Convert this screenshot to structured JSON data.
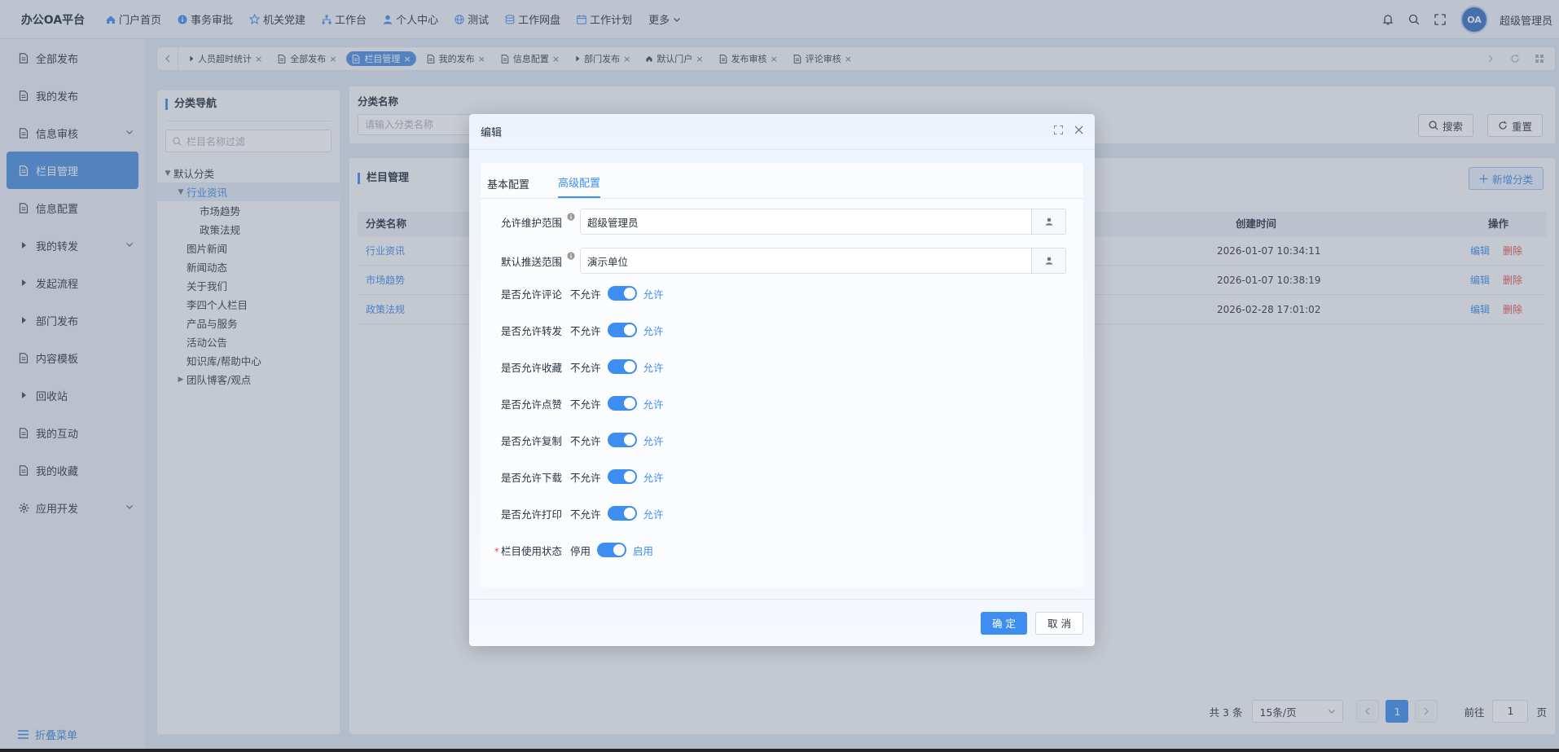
{
  "app": {
    "brand": "办公OA平台"
  },
  "topnav": {
    "items": [
      {
        "label": "门户首页",
        "icon": "home-icon"
      },
      {
        "label": "事务审批",
        "icon": "info-circle-icon"
      },
      {
        "label": "机关党建",
        "icon": "star-icon"
      },
      {
        "label": "工作台",
        "icon": "org-chart-icon"
      },
      {
        "label": "个人中心",
        "icon": "user-icon"
      },
      {
        "label": "测试",
        "icon": "globe-icon"
      },
      {
        "label": "工作网盘",
        "icon": "database-icon"
      },
      {
        "label": "工作计划",
        "icon": "calendar-icon"
      },
      {
        "label": "更多",
        "icon": "chevron-down-icon"
      }
    ],
    "avatar_text": "OA",
    "username": "超级管理员"
  },
  "sidebar": {
    "items": [
      {
        "label": "全部发布",
        "icon": "document-icon",
        "expandable": false,
        "caret": false
      },
      {
        "label": "我的发布",
        "icon": "document-icon",
        "expandable": false,
        "caret": false
      },
      {
        "label": "信息审核",
        "icon": "document-icon",
        "expandable": true,
        "caret": false
      },
      {
        "label": "栏目管理",
        "icon": "document-icon",
        "expandable": false,
        "caret": false,
        "active": true
      },
      {
        "label": "信息配置",
        "icon": "document-icon",
        "expandable": false,
        "caret": false
      },
      {
        "label": "我的转发",
        "icon": "caret-right-icon",
        "expandable": true,
        "caret": true
      },
      {
        "label": "发起流程",
        "icon": "caret-right-icon",
        "expandable": false,
        "caret": true
      },
      {
        "label": "部门发布",
        "icon": "caret-right-icon",
        "expandable": false,
        "caret": true
      },
      {
        "label": "内容模板",
        "icon": "document-icon",
        "expandable": false,
        "caret": false
      },
      {
        "label": "回收站",
        "icon": "caret-right-icon",
        "expandable": false,
        "caret": true
      },
      {
        "label": "我的互动",
        "icon": "document-icon",
        "expandable": false,
        "caret": false
      },
      {
        "label": "我的收藏",
        "icon": "document-icon",
        "expandable": false,
        "caret": false
      },
      {
        "label": "应用开发",
        "icon": "gear-icon",
        "expandable": true,
        "caret": false
      }
    ],
    "collapse_label": "折叠菜单"
  },
  "pagetabs": [
    {
      "label": "人员超时统计",
      "icon": "caret"
    },
    {
      "label": "全部发布",
      "icon": "doc"
    },
    {
      "label": "栏目管理",
      "icon": "doc",
      "active": true
    },
    {
      "label": "我的发布",
      "icon": "doc"
    },
    {
      "label": "信息配置",
      "icon": "doc"
    },
    {
      "label": "部门发布",
      "icon": "caret"
    },
    {
      "label": "默认门户",
      "icon": "home"
    },
    {
      "label": "发布审核",
      "icon": "doc"
    },
    {
      "label": "评论审核",
      "icon": "doc"
    }
  ],
  "tree_panel": {
    "title": "分类导航",
    "filter_placeholder": "栏目名称过滤",
    "nodes": [
      {
        "label": "默认分类",
        "level": 0,
        "caret": "down"
      },
      {
        "label": "行业资讯",
        "level": 1,
        "caret": "down",
        "selected": true
      },
      {
        "label": "市场趋势",
        "level": 2,
        "caret": ""
      },
      {
        "label": "政策法规",
        "level": 2,
        "caret": ""
      },
      {
        "label": "图片新闻",
        "level": 1,
        "caret": ""
      },
      {
        "label": "新闻动态",
        "level": 1,
        "caret": ""
      },
      {
        "label": "关于我们",
        "level": 1,
        "caret": ""
      },
      {
        "label": "李四个人栏目",
        "level": 1,
        "caret": ""
      },
      {
        "label": "产品与服务",
        "level": 1,
        "caret": ""
      },
      {
        "label": "活动公告",
        "level": 1,
        "caret": ""
      },
      {
        "label": "知识库/帮助中心",
        "level": 1,
        "caret": ""
      },
      {
        "label": "团队博客/观点",
        "level": 1,
        "caret": "right"
      }
    ]
  },
  "search": {
    "label": "分类名称",
    "placeholder": "请输入分类名称",
    "search_btn": "搜索",
    "reset_btn": "重置"
  },
  "table": {
    "title": "栏目管理",
    "add_btn": "新增分类",
    "columns": {
      "name": "分类名称",
      "created": "创建时间",
      "ops": "操作"
    },
    "rows": [
      {
        "name": "行业资讯",
        "created": "2026-01-07 10:34:11",
        "edit": "编辑",
        "del": "删除"
      },
      {
        "name": "市场趋势",
        "created": "2026-01-07 10:38:19",
        "edit": "编辑",
        "del": "删除"
      },
      {
        "name": "政策法规",
        "created": "2026-02-28 17:01:02",
        "edit": "编辑",
        "del": "删除"
      }
    ],
    "pager": {
      "total": "共 3 条",
      "page_size": "15条/页",
      "current": "1",
      "goto_label": "前往",
      "goto_value": "1",
      "page_suffix": "页"
    }
  },
  "modal": {
    "title": "编辑",
    "tabs": [
      {
        "label": "基本配置"
      },
      {
        "label": "高级配置",
        "active": true
      }
    ],
    "pickers": [
      {
        "label": "允许维护范围",
        "value": "超级管理员"
      },
      {
        "label": "默认推送范围",
        "value": "演示单位"
      }
    ],
    "switches": [
      {
        "label": "是否允许评论",
        "off": "不允许",
        "on": "允许",
        "value": true
      },
      {
        "label": "是否允许转发",
        "off": "不允许",
        "on": "允许",
        "value": true
      },
      {
        "label": "是否允许收藏",
        "off": "不允许",
        "on": "允许",
        "value": true
      },
      {
        "label": "是否允许点赞",
        "off": "不允许",
        "on": "允许",
        "value": true
      },
      {
        "label": "是否允许复制",
        "off": "不允许",
        "on": "允许",
        "value": true
      },
      {
        "label": "是否允许下载",
        "off": "不允许",
        "on": "允许",
        "value": true
      },
      {
        "label": "是否允许打印",
        "off": "不允许",
        "on": "允许",
        "value": true
      }
    ],
    "status": {
      "required_mark": "*",
      "label": "栏目使用状态",
      "off": "停用",
      "on": "启用",
      "value": true
    },
    "ok": "确 定",
    "cancel": "取 消"
  },
  "colors": {
    "accent": "#3d8ef0",
    "danger": "#e05454",
    "active_menu": "#4a90e2"
  }
}
